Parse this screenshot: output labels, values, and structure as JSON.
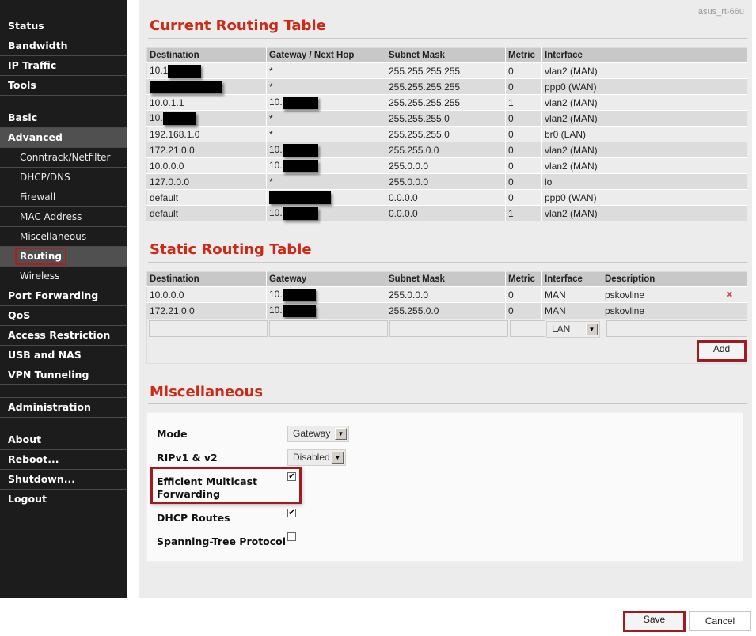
{
  "sidebar": {
    "items": [
      {
        "label": "Status"
      },
      {
        "label": "Bandwidth"
      },
      {
        "label": "IP Traffic"
      },
      {
        "label": "Tools"
      },
      {
        "label": "Basic"
      },
      {
        "label": "Advanced"
      },
      {
        "label": "Conntrack/Netfilter"
      },
      {
        "label": "DHCP/DNS"
      },
      {
        "label": "Firewall"
      },
      {
        "label": "MAC Address"
      },
      {
        "label": "Miscellaneous"
      },
      {
        "label": "Routing"
      },
      {
        "label": "Wireless"
      },
      {
        "label": "Port Forwarding"
      },
      {
        "label": "QoS"
      },
      {
        "label": "Access Restriction"
      },
      {
        "label": "USB and NAS"
      },
      {
        "label": "VPN Tunneling"
      },
      {
        "label": "Administration"
      },
      {
        "label": "About"
      },
      {
        "label": "Reboot..."
      },
      {
        "label": "Shutdown..."
      },
      {
        "label": "Logout"
      }
    ],
    "active": "Routing"
  },
  "header": {
    "hostname": "asus_rt-66u"
  },
  "current_routing": {
    "title": "Current Routing Table",
    "columns": [
      "Destination",
      "Gateway / Next Hop",
      "Subnet Mask",
      "Metric",
      "Interface"
    ],
    "rows": [
      {
        "destination": "10.1",
        "gateway": "*",
        "mask": "255.255.255.255",
        "metric": "0",
        "interface": "vlan2 (MAN)"
      },
      {
        "destination": "",
        "gateway": "*",
        "mask": "255.255.255.255",
        "metric": "0",
        "interface": "ppp0 (WAN)"
      },
      {
        "destination": "10.0.1.1",
        "gateway": "10.",
        "mask": "255.255.255.255",
        "metric": "1",
        "interface": "vlan2 (MAN)"
      },
      {
        "destination": "10.",
        "gateway": "*",
        "mask": "255.255.255.0",
        "metric": "0",
        "interface": "vlan2 (MAN)"
      },
      {
        "destination": "192.168.1.0",
        "gateway": "*",
        "mask": "255.255.255.0",
        "metric": "0",
        "interface": "br0 (LAN)"
      },
      {
        "destination": "172.21.0.0",
        "gateway": "10.",
        "mask": "255.255.0.0",
        "metric": "0",
        "interface": "vlan2 (MAN)"
      },
      {
        "destination": "10.0.0.0",
        "gateway": "10.",
        "mask": "255.0.0.0",
        "metric": "0",
        "interface": "vlan2 (MAN)"
      },
      {
        "destination": "127.0.0.0",
        "gateway": "*",
        "mask": "255.0.0.0",
        "metric": "0",
        "interface": "lo"
      },
      {
        "destination": "default",
        "gateway": "",
        "mask": "0.0.0.0",
        "metric": "0",
        "interface": "ppp0 (WAN)"
      },
      {
        "destination": "default",
        "gateway": "10.",
        "mask": "0.0.0.0",
        "metric": "1",
        "interface": "vlan2 (MAN)"
      }
    ]
  },
  "static_routing": {
    "title": "Static Routing Table",
    "columns": [
      "Destination",
      "Gateway",
      "Subnet Mask",
      "Metric",
      "Interface",
      "Description"
    ],
    "rows": [
      {
        "destination": "10.0.0.0",
        "gateway": "10.",
        "mask": "255.0.0.0",
        "metric": "0",
        "interface": "MAN",
        "description": "pskovline"
      },
      {
        "destination": "172.21.0.0",
        "gateway": "10.",
        "mask": "255.255.0.0",
        "metric": "0",
        "interface": "MAN",
        "description": "pskovline"
      }
    ],
    "new_row": {
      "destination": "",
      "gateway": "",
      "mask": "",
      "metric": "",
      "interface": "LAN",
      "description": ""
    },
    "delete_icon": "✖",
    "add_label": "Add"
  },
  "misc": {
    "title": "Miscellaneous",
    "mode": {
      "label": "Mode",
      "value": "Gateway"
    },
    "rip": {
      "label": "RIPv1 & v2",
      "value": "Disabled"
    },
    "efm": {
      "label_line1": "Efficient Multicast",
      "label_line2": "Forwarding",
      "checked": true
    },
    "dhcp_routes": {
      "label": "DHCP Routes",
      "checked": true
    },
    "stp": {
      "label": "Spanning-Tree Protocol",
      "checked": false
    }
  },
  "footer": {
    "save_label": "Save",
    "cancel_label": "Cancel"
  },
  "glyphs": {
    "check": "✔",
    "dropdown": "▼"
  }
}
